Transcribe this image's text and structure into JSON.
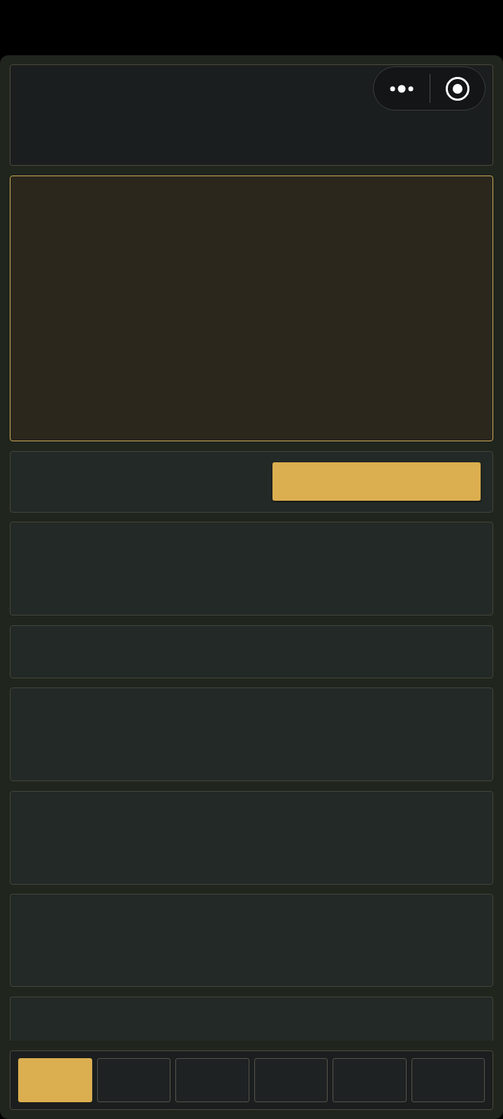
{
  "panels": [
    {
      "kind": "highlighted"
    },
    {
      "kind": "button_row"
    },
    {
      "kind": "plain"
    },
    {
      "kind": "plain"
    },
    {
      "kind": "plain"
    },
    {
      "kind": "plain"
    },
    {
      "kind": "plain"
    },
    {
      "kind": "plain"
    }
  ],
  "tab_bar": {
    "tabs": [
      {
        "selected": true
      },
      {
        "selected": false
      },
      {
        "selected": false
      },
      {
        "selected": false
      },
      {
        "selected": false
      },
      {
        "selected": false
      }
    ]
  }
}
